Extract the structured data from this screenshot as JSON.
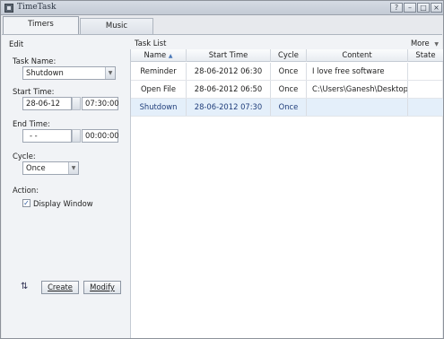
{
  "window": {
    "title": "TimeTask"
  },
  "tabs": [
    {
      "label": "Timers",
      "active": true
    },
    {
      "label": "Music",
      "active": false
    }
  ],
  "left": {
    "heading": "Edit",
    "task_name_label": "Task Name:",
    "task_name_value": "Shutdown",
    "start_time_label": "Start Time:",
    "start_date": "28-06-12",
    "start_time": "07:30:00",
    "end_time_label": "End Time:",
    "end_date": "-  -",
    "end_time": "00:00:00",
    "cycle_label": "Cycle:",
    "cycle_value": "Once",
    "action_label": "Action:",
    "display_window_label": "Display Window",
    "display_window_checked": true,
    "create_label": "Create",
    "modify_label": "Modify"
  },
  "list": {
    "title": "Task List",
    "more_label": "More",
    "columns": [
      "Name",
      "Start Time",
      "Cycle",
      "Content",
      "State"
    ],
    "sorted_column": "Name",
    "rows": [
      {
        "name": "Reminder",
        "start": "28-06-2012 06:30",
        "cycle": "Once",
        "content": "I love free software",
        "state": ""
      },
      {
        "name": "Open File",
        "start": "28-06-2012 06:50",
        "cycle": "Once",
        "content": "C:\\Users\\Ganesh\\Desktop\\...",
        "state": ""
      },
      {
        "name": "Shutdown",
        "start": "28-06-2012 07:30",
        "cycle": "Once",
        "content": "",
        "state": "",
        "selected": true
      }
    ]
  },
  "colors": {
    "selected_row": "#e4effa",
    "panel": "#f1f3f6",
    "accent": "#1f3d7a"
  }
}
